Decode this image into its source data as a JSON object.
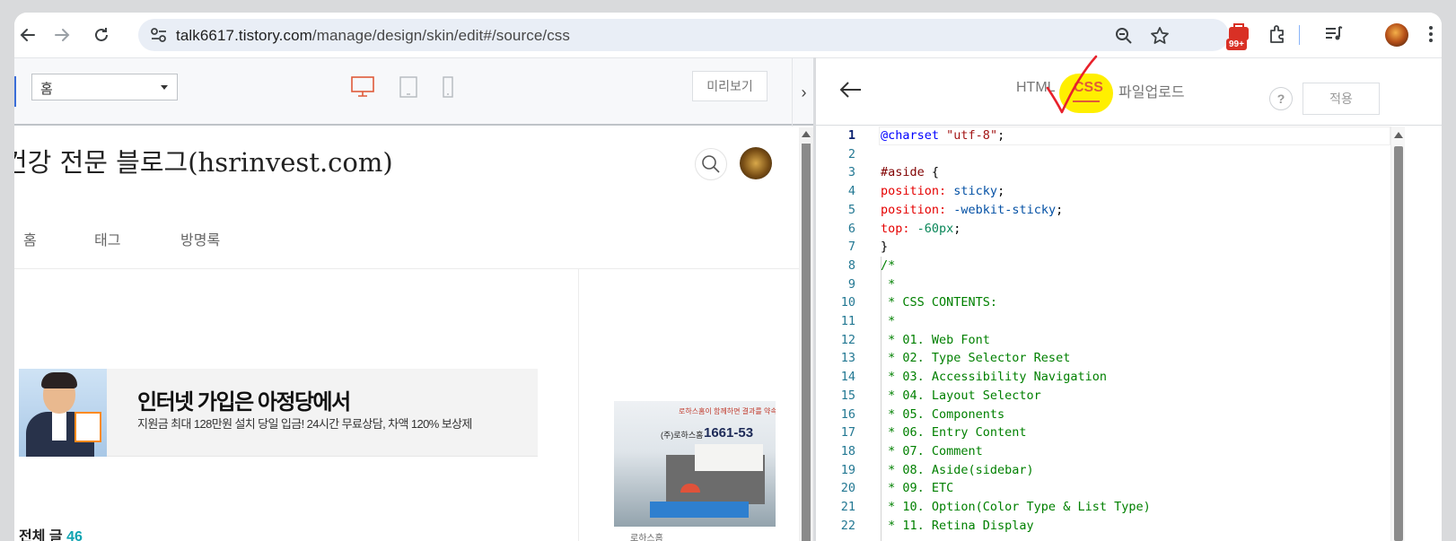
{
  "browser": {
    "url_host": "talk6617.tistory.com",
    "url_path": "/manage/design/skin/edit#/source/css",
    "extensions_badge": "99+",
    "icons": [
      "back-icon",
      "forward-icon",
      "reload-icon",
      "site-settings-icon",
      "zoom-icon",
      "bookmark-star-icon",
      "extension-badge-icon",
      "puzzle-icon",
      "media-queue-icon",
      "profile-avatar-icon",
      "more-menu-icon"
    ]
  },
  "left_header": {
    "page_select_value": "홈",
    "preview_label": "미리보기",
    "collapse_label": "›",
    "devices": [
      "desktop-icon",
      "tablet-icon",
      "mobile-icon"
    ]
  },
  "blog": {
    "title": "건강 전문 블로그(hsrinvest.com)",
    "menu": [
      "홈",
      "태그",
      "방명록"
    ],
    "ad_title": "인터넷 가입은 아정당에서",
    "ad_subtitle": "지원금 최대 128만원 설치 당일 입금! 24시간 무료상담, 차액 120% 보상제",
    "side_ad_topline": "로하스홈이 함께하면 결과를 약속드립니다",
    "side_ad_brand": "(주)로하스홈",
    "side_ad_phone": "1661-53",
    "side_ad_caption": "로하스홈",
    "count_label": "전체 글",
    "count_value": "46"
  },
  "right_header": {
    "tabs": [
      "HTML",
      "CSS",
      "파일업로드"
    ],
    "active_tab": "CSS",
    "help_label": "?",
    "apply_label": "적용"
  },
  "code_lines": [
    {
      "n": "1",
      "text": "@charset \"utf-8\";"
    },
    {
      "n": "2",
      "text": ""
    },
    {
      "n": "3",
      "text": "#aside {"
    },
    {
      "n": "4",
      "text": "position: sticky;"
    },
    {
      "n": "5",
      "text": "position: -webkit-sticky;"
    },
    {
      "n": "6",
      "text": "top: -60px;"
    },
    {
      "n": "7",
      "text": "}"
    },
    {
      "n": "8",
      "text": "/*"
    },
    {
      "n": "9",
      "text": " *"
    },
    {
      "n": "10",
      "text": " * CSS CONTENTS:"
    },
    {
      "n": "11",
      "text": " *"
    },
    {
      "n": "12",
      "text": " * 01. Web Font"
    },
    {
      "n": "13",
      "text": " * 02. Type Selector Reset"
    },
    {
      "n": "14",
      "text": " * 03. Accessibility Navigation"
    },
    {
      "n": "15",
      "text": " * 04. Layout Selector"
    },
    {
      "n": "16",
      "text": " * 05. Components"
    },
    {
      "n": "17",
      "text": " * 06. Entry Content"
    },
    {
      "n": "18",
      "text": " * 07. Comment"
    },
    {
      "n": "19",
      "text": " * 08. Aside(sidebar)"
    },
    {
      "n": "20",
      "text": " * 09. ETC"
    },
    {
      "n": "21",
      "text": " * 10. Option(Color Type & List Type)"
    },
    {
      "n": "22",
      "text": " * 11. Retina Display"
    }
  ],
  "colors": {
    "accent": "#e05a3a",
    "highlight": "#ffef00",
    "checkmark": "#e8212b",
    "count_accent": "#0fa3b1"
  }
}
